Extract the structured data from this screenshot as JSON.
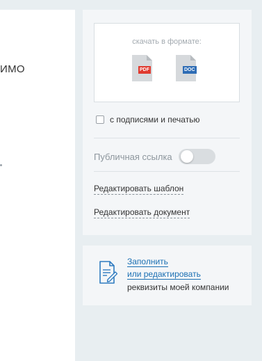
{
  "left_panel": {
    "text_fragment": "ИМО"
  },
  "download": {
    "caption": "скачать в формате:",
    "pdf_label": "PDF",
    "doc_label": "DOC"
  },
  "signatures_checkbox": {
    "label": "с подписями и печатью",
    "checked": false
  },
  "public_link": {
    "label": "Публичная ссылка",
    "enabled": false
  },
  "actions": {
    "edit_template": "Редактировать шаблон",
    "edit_document": "Редактировать документ"
  },
  "company_fill": {
    "link_line1": "Заполнить",
    "link_line2": "или редактировать",
    "note": "реквизиты моей компании"
  },
  "colors": {
    "pdf": "#e03a2f",
    "doc": "#2f6db5",
    "link": "#1a6fb3",
    "background": "#e8eef1"
  }
}
